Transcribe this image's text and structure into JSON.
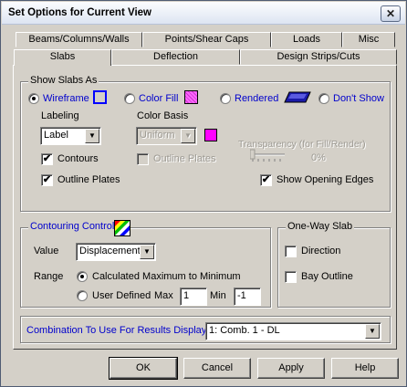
{
  "window": {
    "title": "Set Options for Current View",
    "close_glyph": "✕"
  },
  "tabs": {
    "row1": [
      "Beams/Columns/Walls",
      "Points/Shear Caps",
      "Loads",
      "Misc"
    ],
    "row2": [
      "Slabs",
      "Deflection",
      "Design Strips/Cuts"
    ],
    "active": "Slabs"
  },
  "show_slabs": {
    "group_title": "Show Slabs As",
    "options": [
      {
        "label": "Wireframe",
        "selected": true
      },
      {
        "label": "Color Fill",
        "selected": false
      },
      {
        "label": "Rendered",
        "selected": false
      },
      {
        "label": "Don't Show",
        "selected": false
      }
    ],
    "labeling_label": "Labeling",
    "labeling_value": "Label",
    "color_basis_label": "Color Basis",
    "color_basis_value": "Uniform",
    "contours_label": "Contours",
    "contours_checked": true,
    "outline_plates_disabled_label": "Outline Plates",
    "outline_plates_disabled_checked": false,
    "outline_plates_label": "Outline Plates",
    "outline_plates_checked": true,
    "transparency_label": "Transparency (for Fill/Render)",
    "transparency_value": "0%",
    "show_opening_edges_label": "Show Opening Edges",
    "show_opening_edges_checked": true
  },
  "contouring": {
    "group_title": "Contouring Control",
    "value_label": "Value",
    "value_selected": "Displacement",
    "range_label": "Range",
    "range_options": [
      {
        "label": "Calculated Maximum to Minimum",
        "selected": true
      },
      {
        "label": "User Defined",
        "selected": false
      }
    ],
    "max_label": "Max",
    "max_value": "1",
    "min_label": "Min",
    "min_value": "-1"
  },
  "one_way_slab": {
    "group_title": "One-Way Slab",
    "direction_label": "Direction",
    "direction_checked": false,
    "bay_outline_label": "Bay Outline",
    "bay_outline_checked": false
  },
  "combination": {
    "label": "Combination To Use For Results Display",
    "value": "1: Comb. 1 - DL"
  },
  "buttons": {
    "ok": "OK",
    "cancel": "Cancel",
    "apply": "Apply",
    "help": "Help"
  },
  "colors": {
    "accent_blue": "#0000cc",
    "wireframe_swatch": "#0000ff",
    "colorfill_swatch": "#ff66ff",
    "magenta": "#ff00ff",
    "dialog_bg": "#d4d0c8"
  },
  "check_glyph": "✔",
  "dropdown_glyph": "▼"
}
